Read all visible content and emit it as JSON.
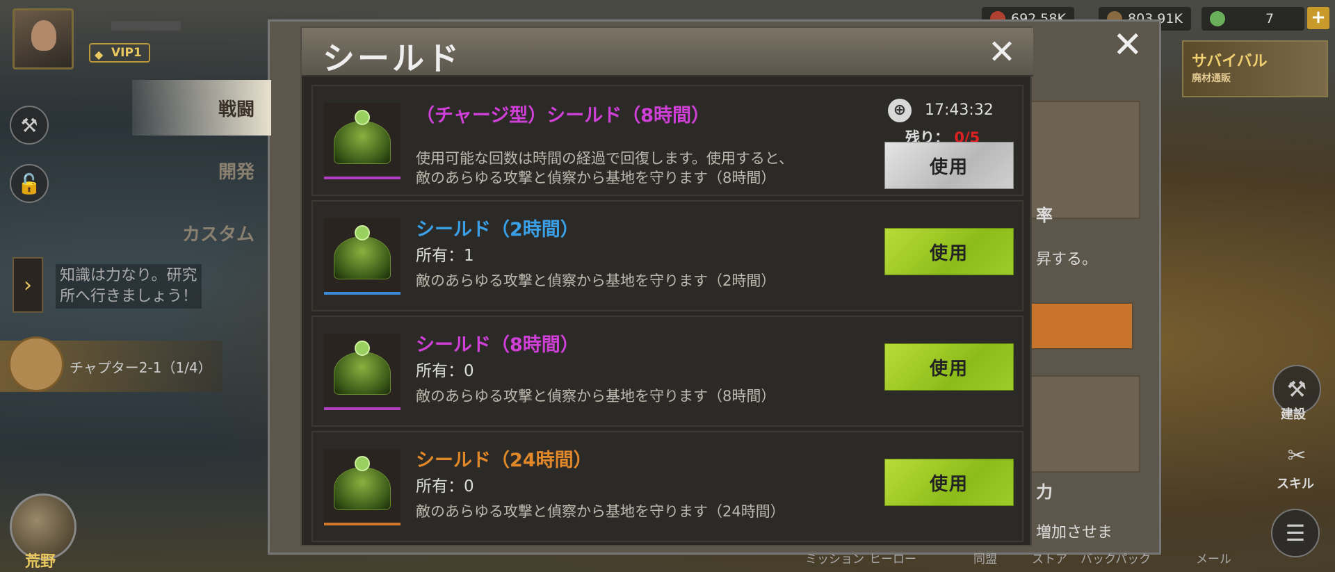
{
  "hud": {
    "vip_label": "VIP1",
    "resources": [
      {
        "name": "food",
        "value": "692.58K",
        "color": "#b04030"
      },
      {
        "name": "wood",
        "value": "803.91K",
        "color": "#8a6a40"
      }
    ],
    "gems": "7",
    "plus_label": "+",
    "survival_title": "サバイバル",
    "survival_sub": "廃材通販"
  },
  "left_menu": {
    "tabs": [
      "戦闘",
      "開発",
      "カスタム"
    ],
    "hint_text_1": "知識は力なり。研究",
    "hint_text_2": "所へ行きましょう！",
    "chapter": "チャプター2-1（1/4）",
    "globe_label": "荒野"
  },
  "bottom_nav": [
    "ミッション",
    "ヒーロー",
    "同盟",
    "ストア",
    "バックパック",
    "メール"
  ],
  "right_side": {
    "build_label": "建設",
    "skill_label": "スキル"
  },
  "back_panel": {
    "text_rate": "率",
    "text_up": "昇する。",
    "text_power": "力",
    "text_increase": "増加させま"
  },
  "modal": {
    "title": "シールド",
    "items": [
      {
        "name": "（チャージ型）シールド（8時間）",
        "name_color": "#d040d8",
        "frame_color": "#b040c0",
        "desc_1": "使用可能な回数は時間の経過で回復します。使用すると、",
        "desc_2": "敵のあらゆる攻撃と偵察から基地を守ります（8時間）",
        "timer": "17:43:32",
        "remain_label": "残り：",
        "remain_value": "0/5",
        "button": "使用",
        "button_style": "gray"
      },
      {
        "name": "シールド（2時間）",
        "name_color": "#3aa0e8",
        "frame_color": "#3a8ad8",
        "owned": "所有：1",
        "desc": "敵のあらゆる攻撃と偵察から基地を守ります（2時間）",
        "button": "使用",
        "button_style": "green"
      },
      {
        "name": "シールド（8時間）",
        "name_color": "#d040d8",
        "frame_color": "#b040c0",
        "owned": "所有：0",
        "desc": "敵のあらゆる攻撃と偵察から基地を守ります（8時間）",
        "button": "使用",
        "button_style": "green"
      },
      {
        "name": "シールド（24時間）",
        "name_color": "#e0882a",
        "frame_color": "#d0782a",
        "owned": "所有：0",
        "desc": "敵のあらゆる攻撃と偵察から基地を守ります（24時間）",
        "button": "使用",
        "button_style": "green"
      }
    ]
  },
  "icons": {
    "close": "close-icon",
    "clock": "clock-icon",
    "hammer": "hammer-icon",
    "lock": "lock-icon",
    "menu": "menu-icon"
  }
}
